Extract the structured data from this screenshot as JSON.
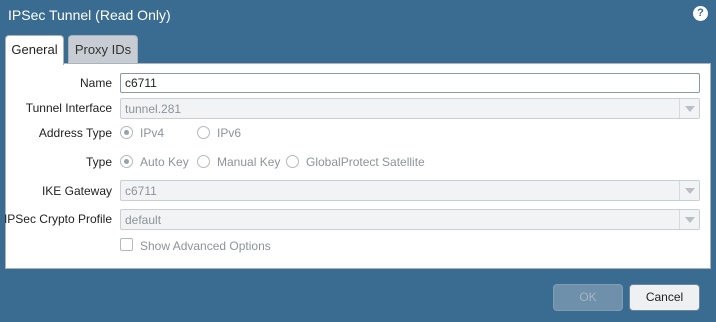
{
  "dialog": {
    "title": "IPSec Tunnel (Read Only)",
    "help_icon": "help-icon",
    "help_glyph": "?"
  },
  "tabs": [
    {
      "label": "General",
      "active": true
    },
    {
      "label": "Proxy IDs",
      "active": false
    }
  ],
  "form": {
    "name_label": "Name",
    "name_value": "c6711",
    "tunnel_interface_label": "Tunnel Interface",
    "tunnel_interface_value": "tunnel.281",
    "address_type_label": "Address Type",
    "address_type_options": [
      {
        "label": "IPv4",
        "checked": true
      },
      {
        "label": "IPv6",
        "checked": false
      }
    ],
    "type_label": "Type",
    "type_options": [
      {
        "label": "Auto Key",
        "checked": true
      },
      {
        "label": "Manual Key",
        "checked": false
      },
      {
        "label": "GlobalProtect Satellite",
        "checked": false
      }
    ],
    "ike_gateway_label": "IKE Gateway",
    "ike_gateway_value": "c6711",
    "crypto_profile_label": "IPSec Crypto Profile",
    "crypto_profile_value": "default",
    "advanced_label": "Show Advanced Options",
    "advanced_checked": false
  },
  "buttons": {
    "ok_label": "OK",
    "cancel_label": "Cancel"
  },
  "colors": {
    "header_bg": "#3a6b91",
    "panel_bg": "#ffffff",
    "disabled_text": "#8d9399"
  }
}
